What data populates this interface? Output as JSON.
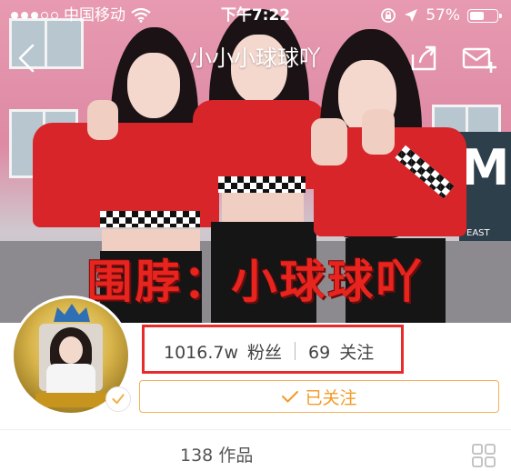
{
  "status_bar": {
    "carrier": "中国移动",
    "time": "下午7:22",
    "battery_text": "57%",
    "battery_level": 0.57,
    "signal_bars_filled": 3,
    "signal_bars_total": 5
  },
  "nav": {
    "title": "小小小球球吖"
  },
  "banner": {
    "caption": "围脖：小球球吖",
    "sign_letter": "M",
    "sign_small": "EAST"
  },
  "profile": {
    "followers_count": "1016.7w",
    "followers_label": "粉丝",
    "following_count": "69",
    "following_label": "关注",
    "follow_button_label": "已关注",
    "works_count": "138",
    "works_label": "作品"
  },
  "colors": {
    "highlight_box": "#e92a2a",
    "follow_accent": "#f39a26",
    "overlay_caption": "#e8241f"
  },
  "icons": {
    "back": "chevron-left-icon",
    "share": "share-icon",
    "message": "message-plus-icon",
    "wifi": "wifi-icon",
    "lock_rotation": "rotation-lock-icon",
    "location": "location-arrow-icon",
    "battery": "battery-icon",
    "checkmark": "checkmark-icon",
    "grid": "grid-view-icon"
  }
}
